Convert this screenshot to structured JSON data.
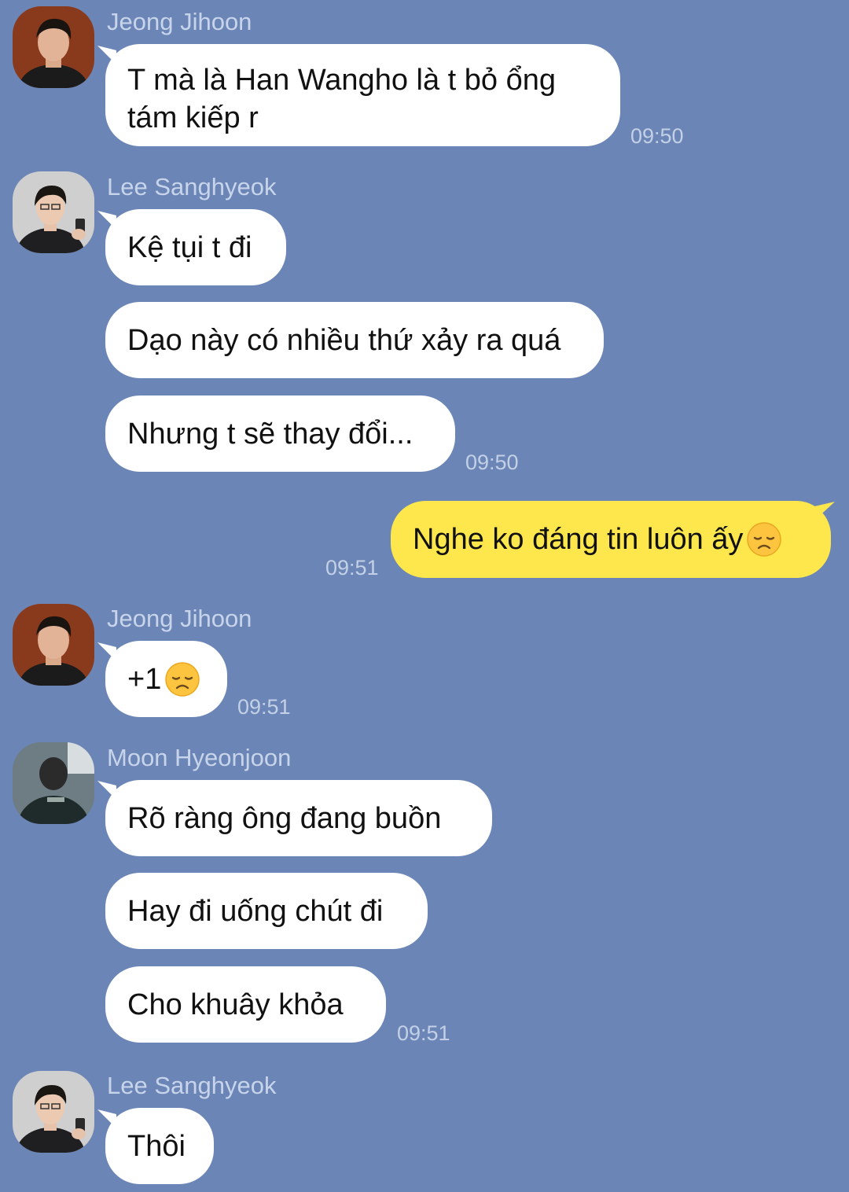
{
  "messages": {
    "m1": {
      "sender": "Jeong Jihoon",
      "text": "T mà là Han Wangho là t bỏ ổng tám kiếp r",
      "time": "09:50"
    },
    "m2": {
      "sender": "Lee Sanghyeok",
      "text": "Kệ tụi t đi"
    },
    "m3": {
      "text": "Dạo này có nhiều thứ xảy ra quá"
    },
    "m4": {
      "text": "Nhưng t sẽ thay đổi...",
      "time": "09:50"
    },
    "m5": {
      "text": "Nghe ko đáng tin luôn ấy",
      "emoji": "disappointed-face",
      "time": "09:51"
    },
    "m6": {
      "sender": "Jeong Jihoon",
      "text": "+1",
      "emoji": "disappointed-face",
      "time": "09:51"
    },
    "m7": {
      "sender": "Moon Hyeonjoon",
      "text": "Rõ ràng ông đang buồn"
    },
    "m8": {
      "text": "Hay đi uống chút đi"
    },
    "m9": {
      "text": "Cho khuây khỏa",
      "time": "09:51"
    },
    "m10": {
      "sender": "Lee Sanghyeok",
      "text": "Thôi"
    }
  },
  "colors": {
    "background": "#6b86b6",
    "incoming_bubble": "#ffffff",
    "outgoing_bubble": "#fde74c",
    "meta_text": "#c7d4ea"
  }
}
